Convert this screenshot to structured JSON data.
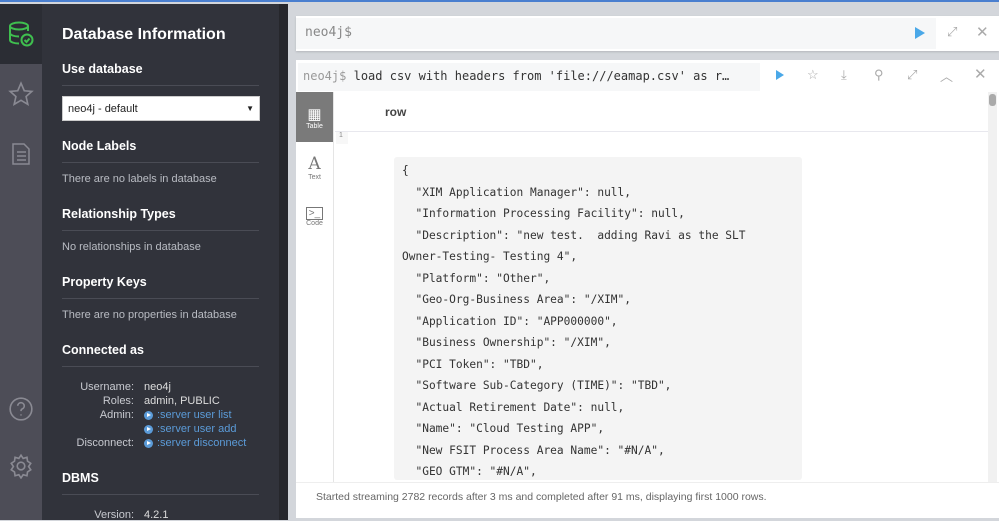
{
  "drawer": {
    "title": "Database Information",
    "use_database": "Use database",
    "selected_db": "neo4j - default",
    "node_labels": "Node Labels",
    "node_labels_empty": "There are no labels in database",
    "rel_types": "Relationship Types",
    "rel_types_empty": "No relationships in database",
    "prop_keys": "Property Keys",
    "prop_keys_empty": "There are no properties in database",
    "connected_as": "Connected as",
    "username_label": "Username:",
    "username": "neo4j",
    "roles_label": "Roles:",
    "roles": "admin, PUBLIC",
    "admin_label": "Admin:",
    "admin_links": [
      ":server user list",
      ":server user add"
    ],
    "disconnect_label": "Disconnect:",
    "disconnect_link": ":server disconnect",
    "dbms": "DBMS",
    "version_label": "Version:",
    "version": "4.2.1"
  },
  "editor": {
    "prompt": "neo4j$"
  },
  "frame": {
    "prompt": "neo4j$",
    "command": "load csv with headers from 'file:///eamap.csv' as r…",
    "views": [
      "Table",
      "Text",
      "Code"
    ],
    "column": "row",
    "row_number": "1",
    "code": "{\n  \"XIM Application Manager\": null,\n  \"Information Processing Facility\": null,\n  \"Description\": \"new test.  adding Ravi as the SLT\nOwner-Testing- Testing 4\",\n  \"Platform\": \"Other\",\n  \"Geo-Org-Business Area\": \"/XIM\",\n  \"Application ID\": \"APP000000\",\n  \"Business Ownership\": \"/XIM\",\n  \"PCI Token\": \"TBD\",\n  \"Software Sub-Category (TIME)\": \"TBD\",\n  \"Actual Retirement Date\": null,\n  \"Name\": \"Cloud Testing APP\",\n  \"New FSIT Process Area Name\": \"#N/A\",\n  \"GEO GTM\": \"#N/A\",",
    "status": "Started streaming 2782 records after 3 ms and completed after 91 ms, displaying first 1000 rows."
  },
  "colors": {
    "accent": "#4aa8e8",
    "link": "#5b9bd8",
    "db_icon": "#3fbf4f"
  }
}
